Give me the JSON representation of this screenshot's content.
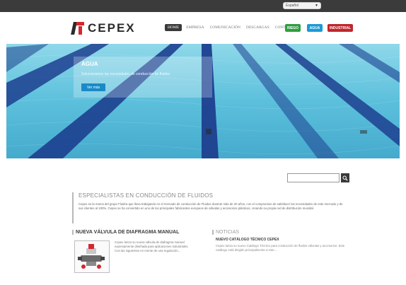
{
  "language_selector": {
    "value": "Español"
  },
  "brand": {
    "name": "CEPEX"
  },
  "nav": {
    "items": [
      {
        "label": "Home"
      },
      {
        "label": "Empresa"
      },
      {
        "label": "Comunicación"
      },
      {
        "label": "Descargas"
      },
      {
        "label": "Contacto"
      }
    ]
  },
  "segments": {
    "riego": "RIEGO",
    "agua": "AGUA",
    "industrial": "INDUSTRIAL"
  },
  "colors": {
    "riego": "#2e9e3f",
    "agua": "#1a9ad6",
    "industrial": "#c0262c"
  },
  "hero": {
    "title": "AGUA",
    "text": "Solucionamos las necesidades de conducción de fluidos",
    "button": "Ver más"
  },
  "search": {
    "value": ""
  },
  "specialists": {
    "title": "Especialistas en conducción de fluidos",
    "text": "Cepex es la marca del grupo Fluidra que lleva trabajando en el mercado de conducción de Fluidos durante más de 20 años, con el compromiso de satisfacer las necesidades de este mercado y de sus clientes al 100%. Cepex se ha convertido en uno de los principales fabricantes europeos de válvulas y accesorios plásticos, creando su propia red de distribución mundial."
  },
  "valve": {
    "title": "Nueva válvula de diafragma manual",
    "text": "Cepex lanza su nueva válvula de diafragma manual expresamente diseñada para aplicaciones industriales. Con las siguientes en mente de una regulación..."
  },
  "news": {
    "title": "Noticias",
    "headline": "NUEVO CATÁLOGO TÉCNICO CEPEX",
    "text": "Cepex lanza su nuevo Catálogo Técnico para conducción de fluidos válvulas y accesorios. Este catálogo está dirigido principalmente a este..."
  }
}
